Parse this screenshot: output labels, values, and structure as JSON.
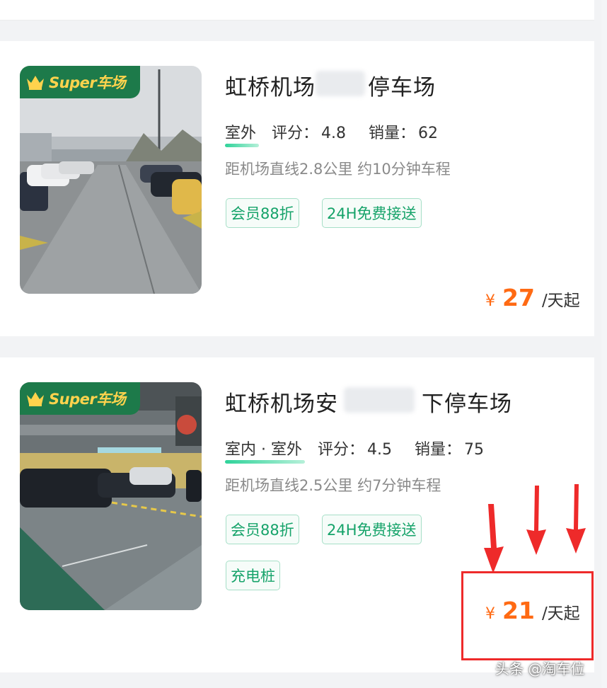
{
  "badge": {
    "text": "Super车场",
    "icon": "crown-icon"
  },
  "listings": [
    {
      "title_a": "虹桥机场",
      "title_b": "停车场",
      "environment": "室外",
      "rating_label": "评分：",
      "rating": "4.8",
      "sales_label": "销量：",
      "sales": "62",
      "distance": "距机场直线2.8公里 约10分钟车程",
      "tags": [
        "会员88折",
        "24H免费接送"
      ],
      "price_currency": "¥",
      "price": "27",
      "price_unit": "/天起"
    },
    {
      "title_a": "虹桥机场安",
      "title_b": "下停车场",
      "environment": "室内 · 室外",
      "rating_label": "评分：",
      "rating": "4.5",
      "sales_label": "销量：",
      "sales": "75",
      "distance": "距机场直线2.5公里 约7分钟车程",
      "tags": [
        "会员88折",
        "24H免费接送",
        "充电桩"
      ],
      "price_currency": "¥",
      "price": "21",
      "price_unit": "/天起"
    }
  ],
  "watermark": "头条 @淘车位",
  "colors": {
    "accent_green": "#16a36a",
    "price_orange": "#ff6a13",
    "badge_green": "#1d7a4a",
    "badge_gold": "#ffd34d",
    "highlight_red": "#ee2a2a"
  }
}
